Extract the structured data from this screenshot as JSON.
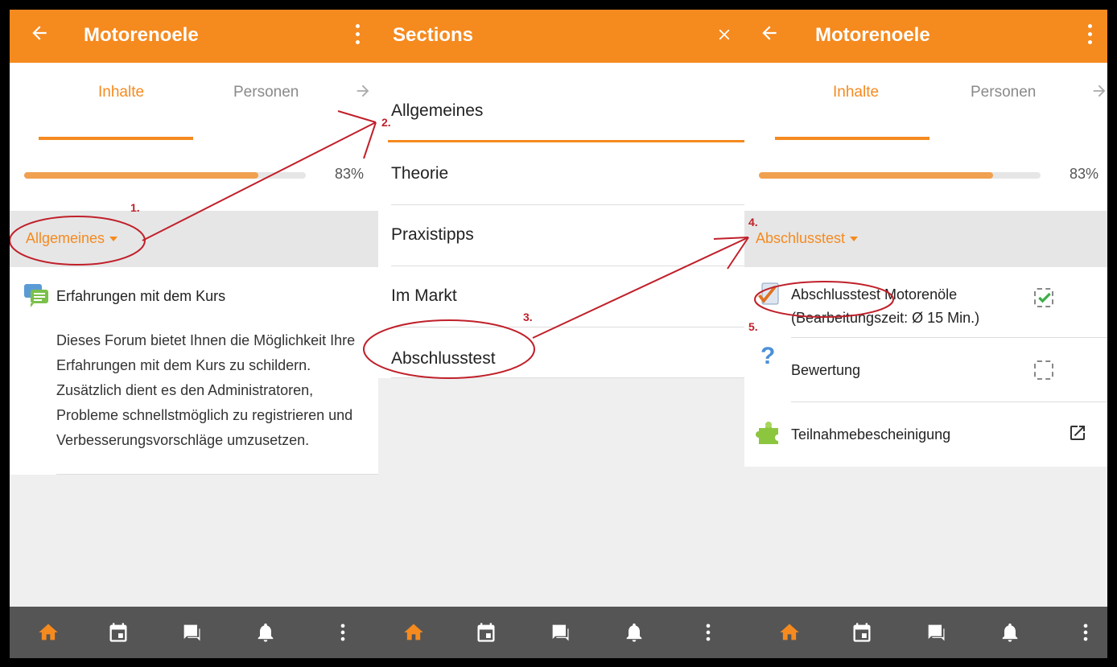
{
  "panel1": {
    "title": "Motorenoele",
    "tabs": [
      "Inhalte",
      "Personen"
    ],
    "progress_percent": 83,
    "progress_label": "83%",
    "section": "Allgemeines",
    "forum_title": "Erfahrungen mit dem Kurs",
    "forum_desc_lines": [
      "Dieses Forum bietet Ihnen die Möglichkeit Ihre",
      "Erfahrungen mit dem Kurs zu schildern.",
      "Zusätzlich dient es den Administratoren,",
      "Probleme schnellstmöglich zu registrieren und",
      "Verbesserungsvorschläge umzusetzen."
    ]
  },
  "panel2": {
    "title": "Sections",
    "sections": [
      "Allgemeines",
      "Theorie",
      "Praxistipps",
      "Im Markt",
      "Abschlusstest"
    ]
  },
  "panel3": {
    "title": "Motorenoele",
    "tabs": [
      "Inhalte",
      "Personen"
    ],
    "progress_percent": 83,
    "progress_label": "83%",
    "section": "Abschlusstest",
    "items": [
      {
        "title": "Abschlusstest Motorenöle",
        "subtitle": "(Bearbeitungszeit: Ø 15 Min.)",
        "icon": "quiz-check-icon",
        "status": "completed"
      },
      {
        "title": "Bewertung",
        "icon": "question-mark-icon",
        "status": "incomplete"
      },
      {
        "title": "Teilnahmebescheinigung",
        "icon": "puzzle-icon",
        "status": "external-link"
      }
    ]
  },
  "annotations": [
    "1.",
    "2.",
    "3.",
    "4.",
    "5."
  ],
  "colors": {
    "accent": "#f58a1f",
    "annotation": "#c0202a",
    "bottom_bar": "#555555"
  }
}
